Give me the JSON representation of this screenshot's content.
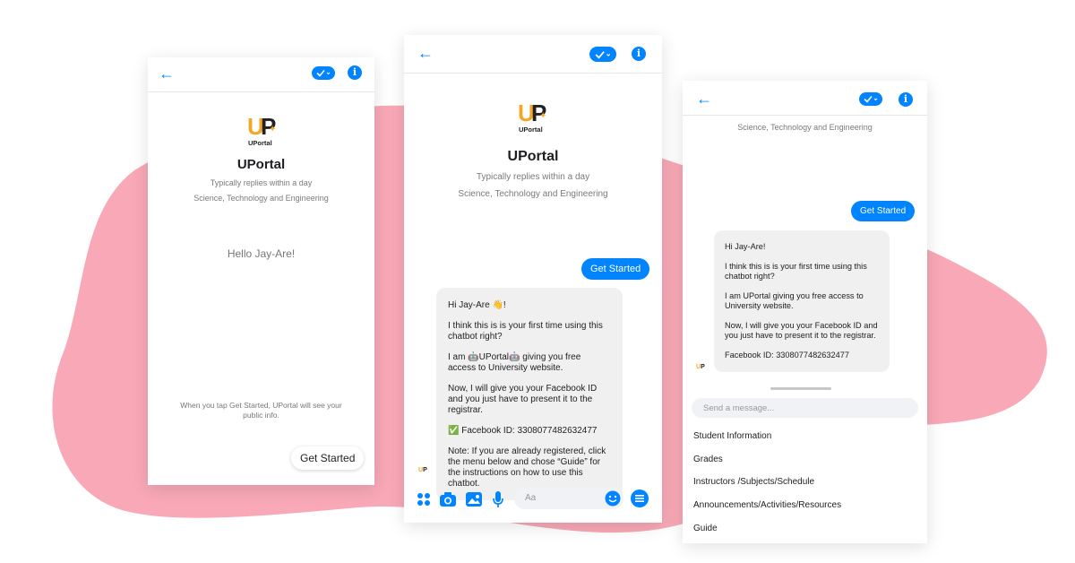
{
  "colors": {
    "accent": "#0084ff",
    "blob": "#f8a8b6",
    "logo_orange": "#f5a623"
  },
  "screen1": {
    "back_icon": "back-arrow-icon",
    "title": "UPortal",
    "logo_text": "UPortal",
    "reply_time": "Typically replies within a day",
    "category": "Science, Technology and Engineering",
    "greeting": "Hello Jay-Are!",
    "notice": "When you tap Get Started, UPortal will see your public info.",
    "get_started": "Get Started"
  },
  "screen2": {
    "title": "UPortal",
    "logo_text": "UPortal",
    "reply_time": "Typically replies within a day",
    "category": "Science, Technology and Engineering",
    "get_started": "Get Started",
    "message": {
      "greeting": "Hi Jay-Are 👋!",
      "line1": "I think this is is your first time using this chatbot right?",
      "line2": "I am 🤖UPortal🤖 giving you free access to University website.",
      "line3": "Now, I will give you your Facebook ID and you just have to present it to the registrar.",
      "line4": "✅ Facebook ID: 3308077482632477",
      "line5": "Note: If you are already registered, click the menu below and chose “Guide” for the instructions on how to use this chatbot."
    },
    "composer_placeholder": "Aa"
  },
  "screen3": {
    "category": "Science, Technology and Engineering",
    "get_started": "Get Started",
    "message": {
      "greeting": "Hi Jay-Are!",
      "line1": "I think this is is your first time using this chatbot right?",
      "line2": "I am UPortal giving you free access to University website.",
      "line3": "Now, I will give you your Facebook ID and you just have to present it to the registrar.",
      "line4": "Facebook ID: 3308077482632477"
    },
    "input_placeholder": "Send a message...",
    "menu": [
      "Student Information",
      "Grades",
      "Instructors /Subjects/Schedule",
      "Announcements/Activities/Resources",
      "Guide"
    ]
  }
}
